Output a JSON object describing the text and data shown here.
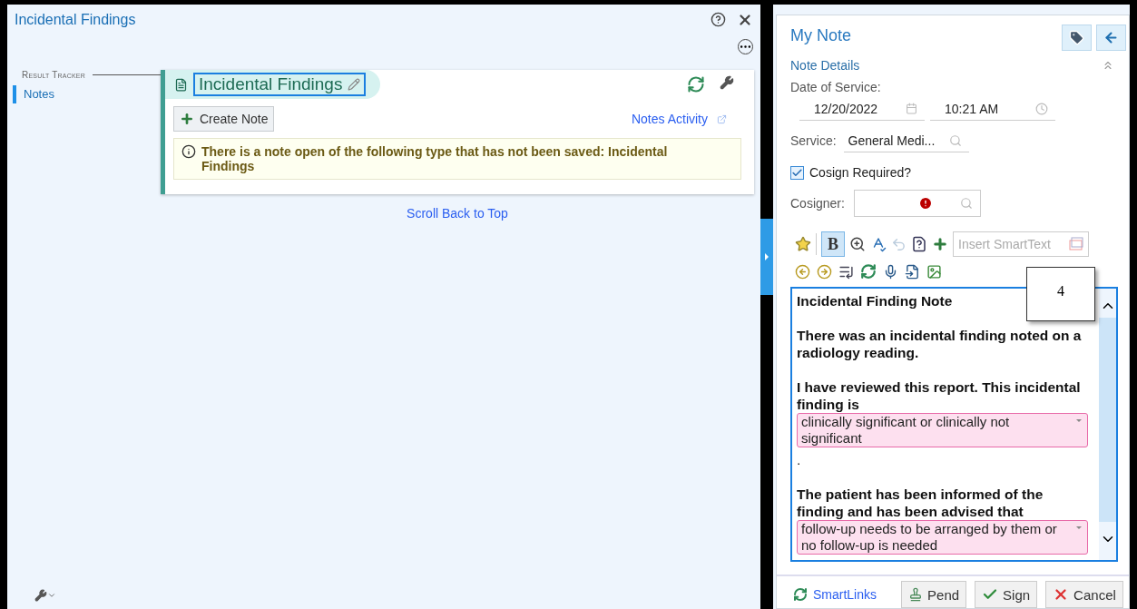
{
  "activity": {
    "title": "Incidental Findings"
  },
  "sidebar": {
    "section": "Result Tracker",
    "items": [
      {
        "label": "Notes",
        "selected": true
      }
    ]
  },
  "card": {
    "title": "Incidental Findings",
    "create_button": "Create Note",
    "link": "Notes Activity",
    "alert": "There is a note open of the following type that has not been saved: Incidental Findings"
  },
  "scroll_link": "Scroll Back to Top",
  "note": {
    "title": "My Note",
    "section": "Note Details",
    "expanded": true,
    "date_label": "Date of Service:",
    "date": "12/20/2022",
    "time": "10:21 AM",
    "service_label": "Service:",
    "service": "General Medi...",
    "cosign": {
      "label": "Cosign Required?",
      "checked": true
    },
    "cosigner_label": "Cosigner:",
    "cosigner_missing": true,
    "bold_button": {
      "label": "B",
      "selected": true
    },
    "smarttext_placeholder": "Insert SmartText",
    "body": [
      {
        "kind": "heading",
        "text": "Incidental Finding Note"
      },
      {
        "kind": "paragraph",
        "text": "There was an incidental finding noted on a radiology reading."
      },
      {
        "kind": "paragraph",
        "text": "I have reviewed this report. This incidental finding is"
      },
      {
        "kind": "smartlist",
        "text": "clinically significant or clinically not significant"
      },
      {
        "kind": "plain",
        "text": "."
      },
      {
        "kind": "paragraph",
        "text": "The patient has been informed of the finding and has been advised that"
      },
      {
        "kind": "smartlist",
        "text": "follow-up needs to be arranged by them or no follow-up is needed"
      }
    ],
    "callout": "4",
    "footer": {
      "smartlinks": "SmartLinks",
      "buttons": [
        {
          "kind": "pend",
          "label": "Pend"
        },
        {
          "kind": "sign",
          "label": "Sign"
        },
        {
          "kind": "cancel",
          "label": "Cancel"
        }
      ]
    }
  }
}
